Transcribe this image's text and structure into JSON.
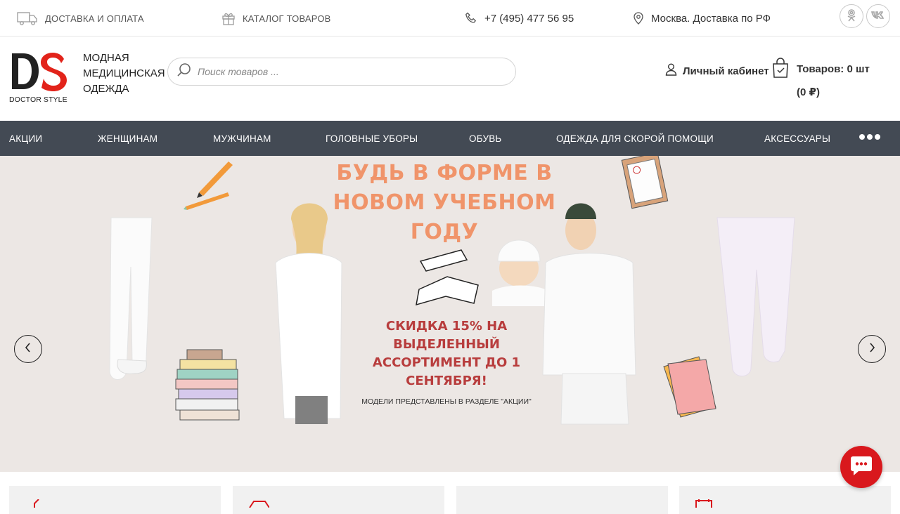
{
  "topbar": {
    "delivery_label": "ДОСТАВКА И ОПЛАТА",
    "catalog_label": "КАТАЛОГ ТОВАРОВ",
    "phone": "+7 (495) 477 56 95",
    "city": "Москва. Доставка по РФ",
    "social_ok_icon": "odnoklassniki-icon",
    "social_vk_label": "vk"
  },
  "header": {
    "logo_text": "DOCTOR STYLE",
    "tagline": "МОДНАЯ МЕДИЦИНСКАЯ ОДЕЖДА",
    "search_placeholder": "Поиск товаров ...",
    "account_label": "Личный кабинет",
    "cart_label": "Товаров: 0 шт",
    "cart_sum": "(0 ₽)"
  },
  "nav": {
    "items": [
      "АКЦИИ",
      "ЖЕНЩИНАМ",
      "МУЖЧИНАМ",
      "ГОЛОВНЫЕ УБОРЫ",
      "ОБУВЬ",
      "ОДЕЖДА ДЛЯ СКОРОЙ ПОМОЩИ",
      "АКСЕССУАРЫ"
    ],
    "more_icon": "more-dots-icon"
  },
  "banner": {
    "headline": "БУДЬ В ФОРМЕ В НОВОМ УЧЕБНОМ ГОДУ",
    "sale": "СКИДКА 15% НА ВЫДЕЛЕННЫЙ АССОРТИМЕНТ ДО 1 СЕНТЯБРЯ!",
    "note": "МОДЕЛИ ПРЕДСТАВЛЕНЫ В РАЗДЕЛЕ \"АКЦИИ\""
  },
  "colors": {
    "nav_bg": "#434a54",
    "banner_bg": "#ece7e4",
    "headline": "#f0946a",
    "sale": "#b83d3d",
    "logo_red": "#e2231a",
    "chat": "#d9181d"
  }
}
